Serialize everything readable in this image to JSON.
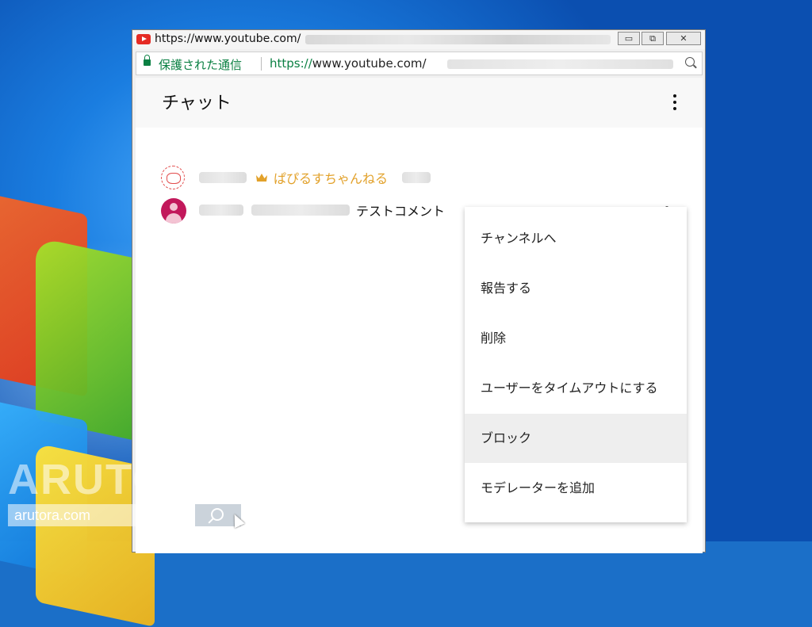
{
  "window": {
    "title": "https://www.youtube.com/",
    "controls": {
      "minimize": "▭",
      "restore": "⧉",
      "close": "✕"
    }
  },
  "addressbar": {
    "secure_label": "保護された通信",
    "url_proto": "https://",
    "url_host": "www.youtube.com/"
  },
  "chat": {
    "title": "チャット",
    "messages": [
      {
        "author": "ぱぴるすちゃんねる",
        "role": "owner",
        "text": ""
      },
      {
        "author": "",
        "role": "viewer",
        "text": "テストコメント"
      }
    ]
  },
  "context_menu": {
    "items": [
      {
        "label": "チャンネルへ"
      },
      {
        "label": "報告する"
      },
      {
        "label": "削除"
      },
      {
        "label": "ユーザーをタイムアウトにする"
      },
      {
        "label": "ブロック",
        "highlighted": true
      },
      {
        "label": "モデレーターを追加"
      }
    ]
  },
  "watermark": {
    "brand": "ARUTORA",
    "url": "arutora.com"
  },
  "colors": {
    "secure_green": "#0b8043",
    "owner_gold": "#e2a12a",
    "youtube_red": "#e52b24",
    "avatar_magenta": "#c2185b"
  },
  "icons": {
    "favicon": "youtube-icon",
    "lock": "lock-icon",
    "zoom": "zoom-icon",
    "owner_badge": "crown-icon",
    "overflow": "more-vert-icon",
    "search": "search-icon"
  }
}
